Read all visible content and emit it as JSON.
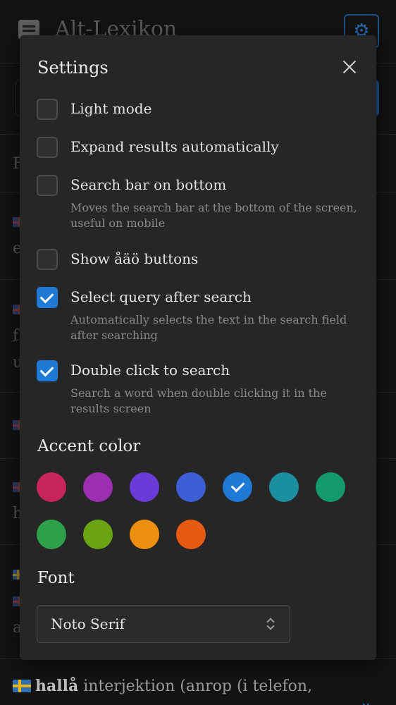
{
  "background": {
    "app_title": "Alt-Lexikon",
    "bottom_entry": {
      "word": "hallå",
      "rest": "interjektion (anrop (i telefon,"
    }
  },
  "settings": {
    "title": "Settings",
    "options": [
      {
        "label": "Light mode",
        "checked": false,
        "help": ""
      },
      {
        "label": "Expand results automatically",
        "checked": false,
        "help": ""
      },
      {
        "label": "Search bar on bottom",
        "checked": false,
        "help": "Moves the search bar at the bottom of the screen, useful on mobile"
      },
      {
        "label": "Show åäö buttons",
        "checked": false,
        "help": ""
      },
      {
        "label": "Select query after search",
        "checked": true,
        "help": "Automatically selects the text in the search field after searching"
      },
      {
        "label": "Double click to search",
        "checked": true,
        "help": "Search a word when double clicking it in the results screen"
      }
    ],
    "accent_color": {
      "label": "Accent color",
      "colors": [
        "#c8245e",
        "#9b2fb0",
        "#6a3bd8",
        "#3c5fd8",
        "#1f7ad6",
        "#1a8fa0",
        "#139a6a",
        "#2ea04a",
        "#6aa313",
        "#ec8f0e",
        "#e65a12"
      ],
      "selected_index": 4
    },
    "font": {
      "label": "Font",
      "value": "Noto Serif"
    }
  }
}
